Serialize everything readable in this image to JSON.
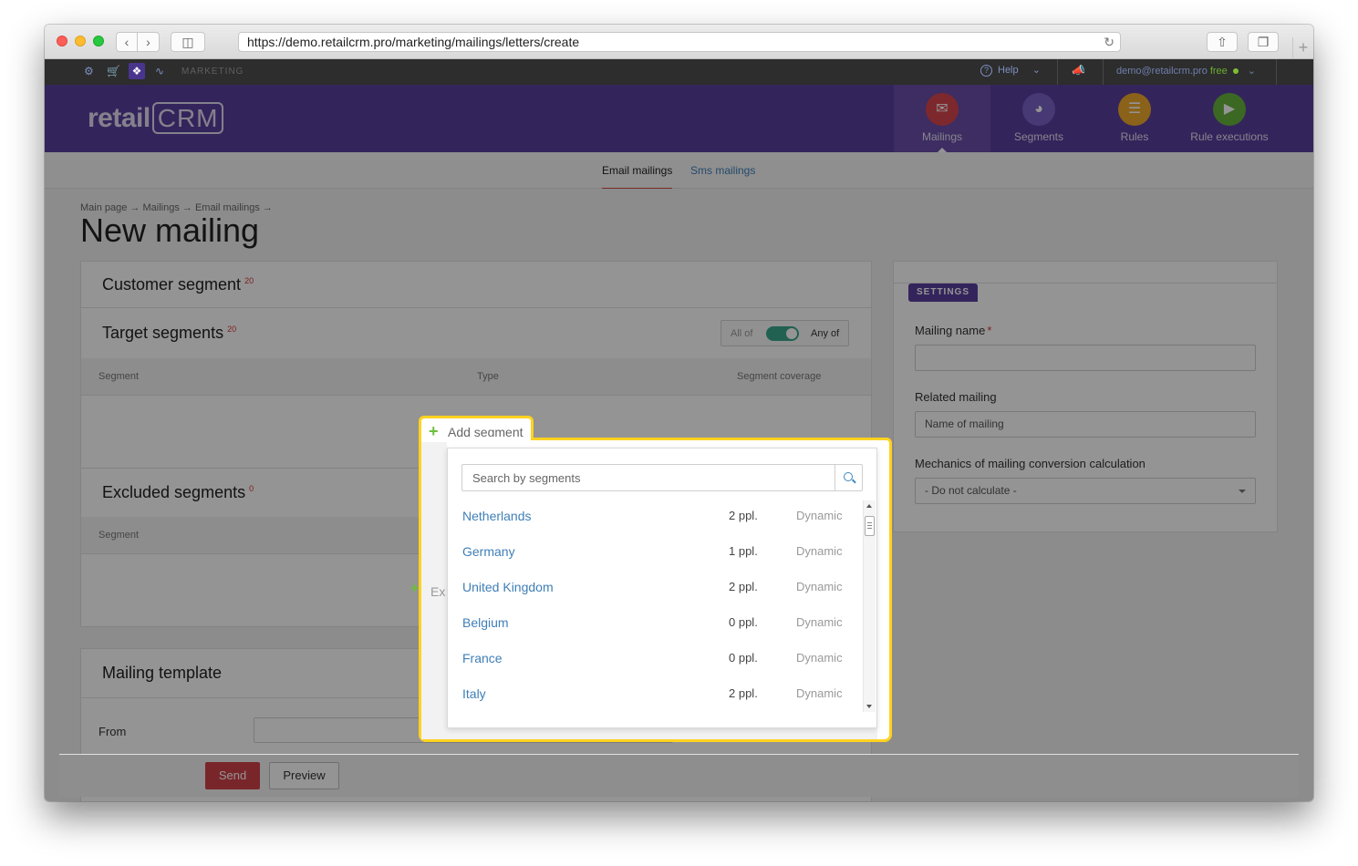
{
  "browser": {
    "url": "https://demo.retailcrm.pro/marketing/mailings/letters/create"
  },
  "topbar": {
    "section": "MARKETING",
    "help": "Help",
    "user_email": "demo@retailcrm.pro",
    "plan": "free"
  },
  "header": {
    "logo_left": "retail",
    "logo_right": "CRM",
    "nav": [
      {
        "label": "Mailings",
        "icon": "mail-icon",
        "color": "#d8454e"
      },
      {
        "label": "Segments",
        "icon": "segments-icon",
        "color": "#7a62c8"
      },
      {
        "label": "Rules",
        "icon": "rules-icon",
        "color": "#f0a92c"
      },
      {
        "label": "Rule executions",
        "icon": "play-icon",
        "color": "#66b43c"
      }
    ]
  },
  "subnav": {
    "email": "Email mailings",
    "sms": "Sms mailings"
  },
  "page": {
    "breadcrumb": "Main page → Mailings → Email mailings →",
    "title": "New mailing"
  },
  "customer_segment": {
    "title": "Customer segment",
    "count": "20"
  },
  "target_segments": {
    "title": "Target segments",
    "count": "20",
    "toggle_all": "All of",
    "toggle_any": "Any of",
    "columns": [
      "Segment",
      "Type",
      "Segment coverage"
    ]
  },
  "excluded_segments": {
    "title": "Excluded segments",
    "count": "0",
    "column": "Segment",
    "add_partial": "Ex"
  },
  "mailing_template": {
    "title": "Mailing template",
    "from_label": "From"
  },
  "settings": {
    "badge": "SETTINGS",
    "mailing_name_label": "Mailing name",
    "related_label": "Related mailing",
    "related_placeholder": "Name of mailing",
    "mechanics_label": "Mechanics of mailing conversion calculation",
    "mechanics_value": "- Do not calculate -"
  },
  "popup": {
    "add_label": "Add segment",
    "search_placeholder": "Search by segments",
    "segments": [
      {
        "name": "Netherlands",
        "count": "2 ppl.",
        "type": "Dynamic"
      },
      {
        "name": "Germany",
        "count": "1 ppl.",
        "type": "Dynamic"
      },
      {
        "name": "United Kingdom",
        "count": "2 ppl.",
        "type": "Dynamic"
      },
      {
        "name": "Belgium",
        "count": "0 ppl.",
        "type": "Dynamic"
      },
      {
        "name": "France",
        "count": "0 ppl.",
        "type": "Dynamic"
      },
      {
        "name": "Italy",
        "count": "2 ppl.",
        "type": "Dynamic"
      }
    ]
  },
  "actions": {
    "send": "Send",
    "preview": "Preview"
  },
  "colors": {
    "brand_purple": "#5b3e9f",
    "highlight_yellow": "#ffd21f",
    "send_red": "#d0434b",
    "link_blue": "#3f7fb7"
  }
}
